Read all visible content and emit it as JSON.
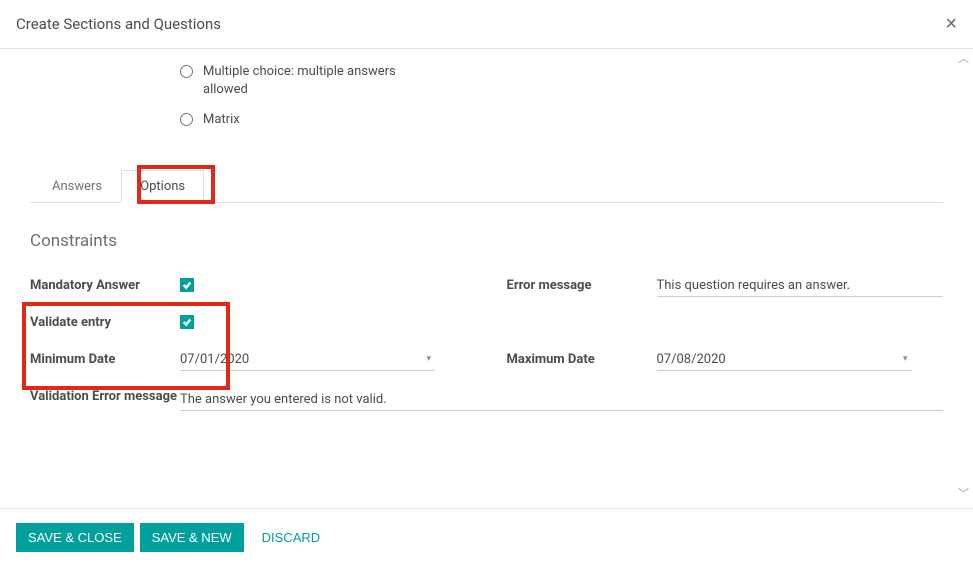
{
  "modal": {
    "title": "Create Sections and Questions"
  },
  "questionTypes": {
    "multipleChoice": "Multiple choice: multiple answers allowed",
    "matrix": "Matrix"
  },
  "tabs": {
    "answers": "Answers",
    "options": "Options"
  },
  "section": {
    "heading": "Constraints"
  },
  "fields": {
    "mandatoryAnswer": {
      "label": "Mandatory Answer",
      "value": true
    },
    "errorMessage": {
      "label": "Error message",
      "value": "This question requires an answer."
    },
    "validateEntry": {
      "label": "Validate entry",
      "value": true
    },
    "minimumDate": {
      "label": "Minimum Date",
      "value": "07/01/2020"
    },
    "maximumDate": {
      "label": "Maximum Date",
      "value": "07/08/2020"
    },
    "validationError": {
      "label": "Validation Error message",
      "value": "The answer you entered is not valid."
    }
  },
  "buttons": {
    "saveClose": "Save & Close",
    "saveNew": "Save & New",
    "discard": "Discard"
  }
}
